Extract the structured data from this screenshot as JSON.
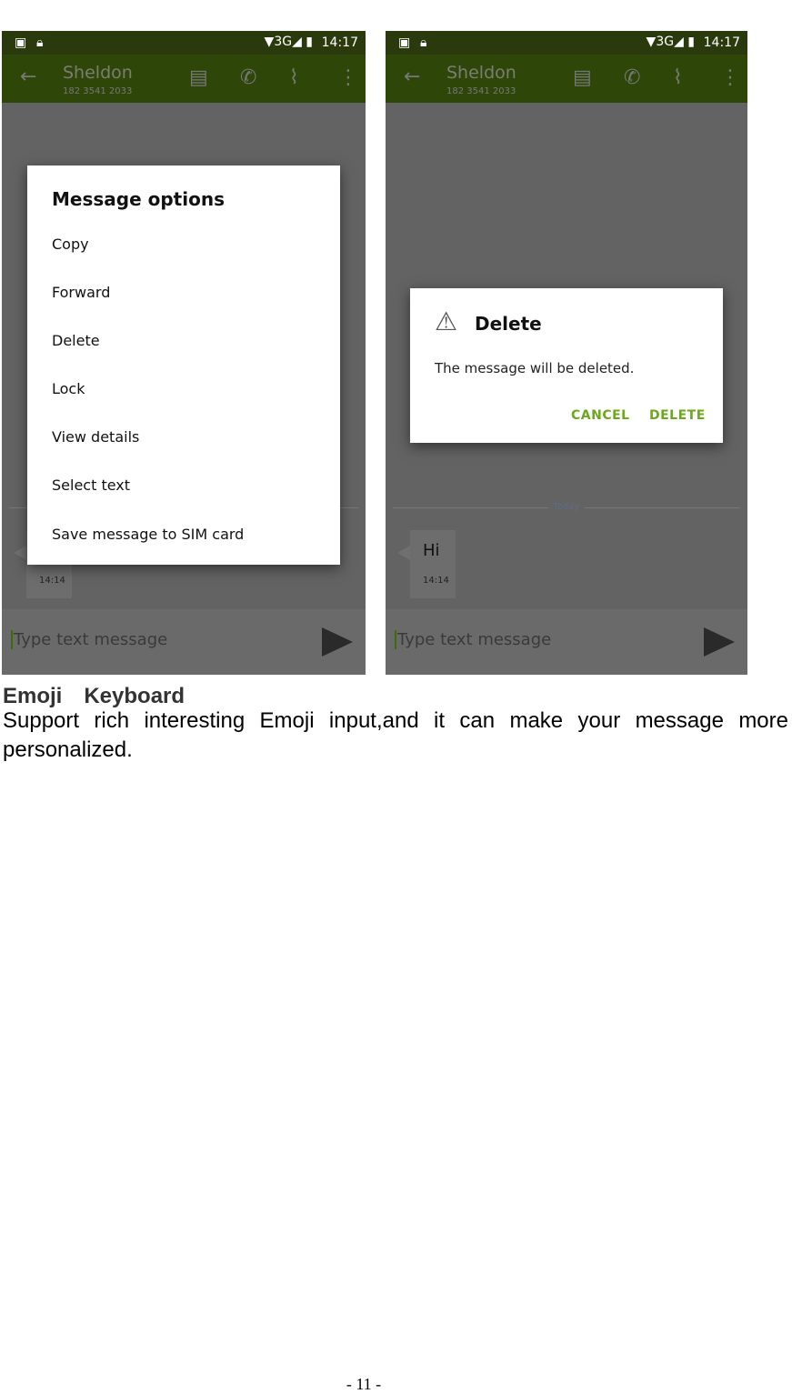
{
  "phone": {
    "status_time": "14:17",
    "network": "3G",
    "contact_name": "Sheldon",
    "contact_number": "182 3541 2033",
    "input_placeholder": "Type text message",
    "today_label": "Today",
    "message_text": "Hi",
    "message_time": "14:14",
    "colors": {
      "statusbar": "#2b3a0c",
      "toolbar": "#2e4709",
      "accent": "#6aaa1a"
    }
  },
  "options_dialog": {
    "title": "Message options",
    "items": [
      "Copy",
      "Forward",
      "Delete",
      "Lock",
      "View details",
      "Select text",
      "Save message to SIM card"
    ]
  },
  "delete_dialog": {
    "title": "Delete",
    "message": "The message will be deleted.",
    "cancel": "CANCEL",
    "delete": "DELETE"
  },
  "doc": {
    "heading": "Emoji　Keyboard",
    "body": "Support rich interesting Emoji input,and it can make your message more personalized.",
    "page_number": "- 11 -"
  }
}
